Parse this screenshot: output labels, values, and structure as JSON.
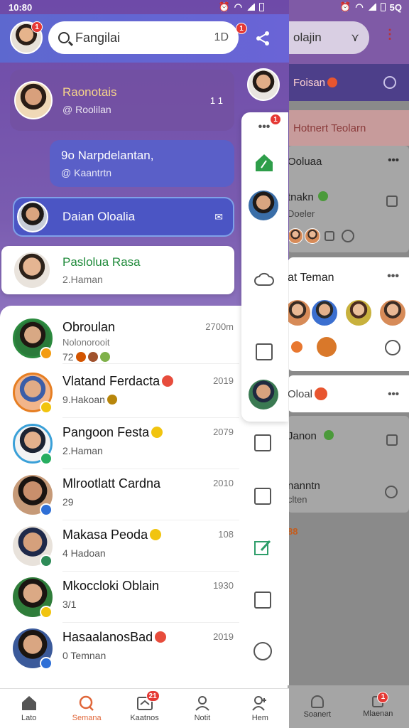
{
  "status_bar": {
    "time": "10:80",
    "right_time": "5Q"
  },
  "header": {
    "search_value": "Fangilai",
    "search_count": "1D",
    "avatar_badge": "1",
    "share_badge": "1"
  },
  "pinned": [
    {
      "name": "Raonotais",
      "sub": "@ Roolilan",
      "meta": "1 1",
      "color": "#f6d48a"
    },
    {
      "name": "9o Narpdelantan,",
      "sub": "@ Kaantrtn",
      "color": "#ffffff"
    },
    {
      "name": "Daian Oloalia",
      "color": "#ffffff"
    },
    {
      "name": "Paslolua Rasa",
      "sub": "2.Haman",
      "color": "#1f8a3a"
    }
  ],
  "chats": [
    {
      "name": "Obroulan",
      "preview": "Nolonorooit",
      "sub": "72",
      "time": "2700m",
      "ring": "#2b8a3e",
      "status": "#f39c12"
    },
    {
      "name": "Vlatand Ferdacta",
      "sub": "9.Hakoan",
      "time": "2019",
      "ring": "#e67e22",
      "status": "#f1c40f"
    },
    {
      "name": "Pangoon Festa",
      "sub": "2.Haman",
      "time": "2079",
      "ring": "#3aa0d8",
      "status": "#27ae60"
    },
    {
      "name": "Mlrootlatt Cardna",
      "sub": "29",
      "time": "2010",
      "ring": "#555555",
      "status": "#2f6fd6"
    },
    {
      "name": "Makasa Peoda",
      "sub": "4 Hadoan",
      "time": "108",
      "ring": "#888888",
      "status": "#2e8b57"
    },
    {
      "name": "Mkoccloki Oblain",
      "sub": "3/1",
      "time": "1930",
      "ring": "#555555",
      "status": "#f1c40f"
    },
    {
      "name": "HasaalanosBad",
      "sub": "0 Temnan",
      "time": "2019",
      "ring": "#666666",
      "status": "#2f6fd6"
    }
  ],
  "bottom_nav": [
    {
      "label": "Lato",
      "icon": "home-icon"
    },
    {
      "label": "Semana",
      "icon": "search-icon",
      "active": true
    },
    {
      "label": "Kaatnos",
      "icon": "inbox-icon",
      "badge": "21"
    },
    {
      "label": "Notit",
      "icon": "person-icon"
    },
    {
      "label": "Hem",
      "icon": "add-person-icon"
    }
  ],
  "rail_badge": "1",
  "background_app": {
    "search_text": "olajin",
    "strip": "Foisan",
    "band": "Hotnert Teolarn",
    "card1": {
      "title": "Ooluaa",
      "row1": "tnakn",
      "row1_sub": "Doeler"
    },
    "group": {
      "title": "at Teman"
    },
    "small_card": {
      "title": "Oloal"
    },
    "card2": {
      "row1": "Janon",
      "row2": "nanntn",
      "row2_sub": "clten"
    },
    "tag": "88",
    "nav": [
      {
        "label": "Soanert"
      },
      {
        "label": "Mlaenan",
        "badge": "1"
      }
    ]
  }
}
